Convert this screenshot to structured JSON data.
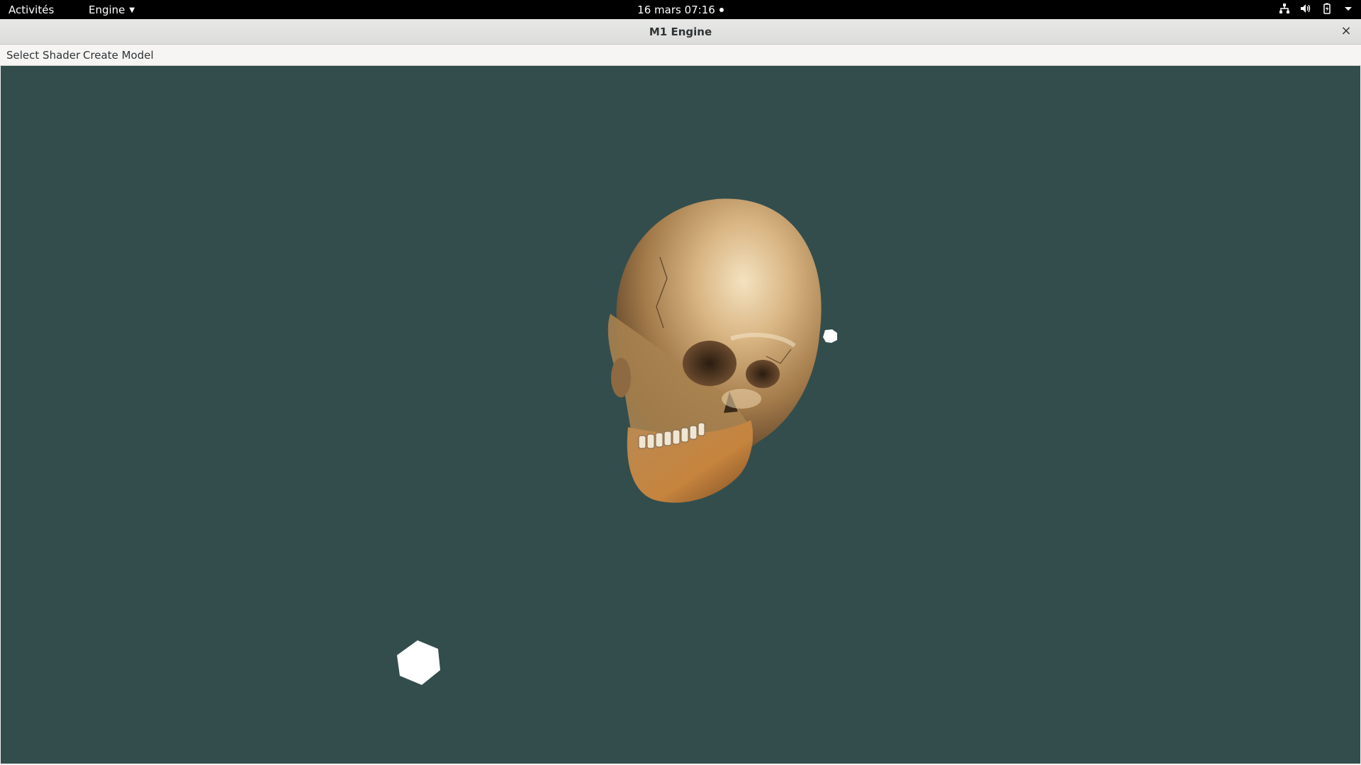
{
  "topbar": {
    "activities_label": "Activités",
    "app_menu_label": "Engine",
    "clock_label": "16 mars  07:16",
    "tray_icons": [
      "network-icon",
      "volume-icon",
      "battery-icon",
      "system-menu-arrow-icon"
    ]
  },
  "window": {
    "title": "M1 Engine",
    "close_label": "×"
  },
  "menubar": {
    "items": [
      {
        "label": "Select Shader"
      },
      {
        "label": "Create Model"
      }
    ]
  },
  "viewport": {
    "background_color": "#334d4d",
    "objects": [
      "skull-model",
      "light-cube-small",
      "light-cube-large"
    ]
  }
}
